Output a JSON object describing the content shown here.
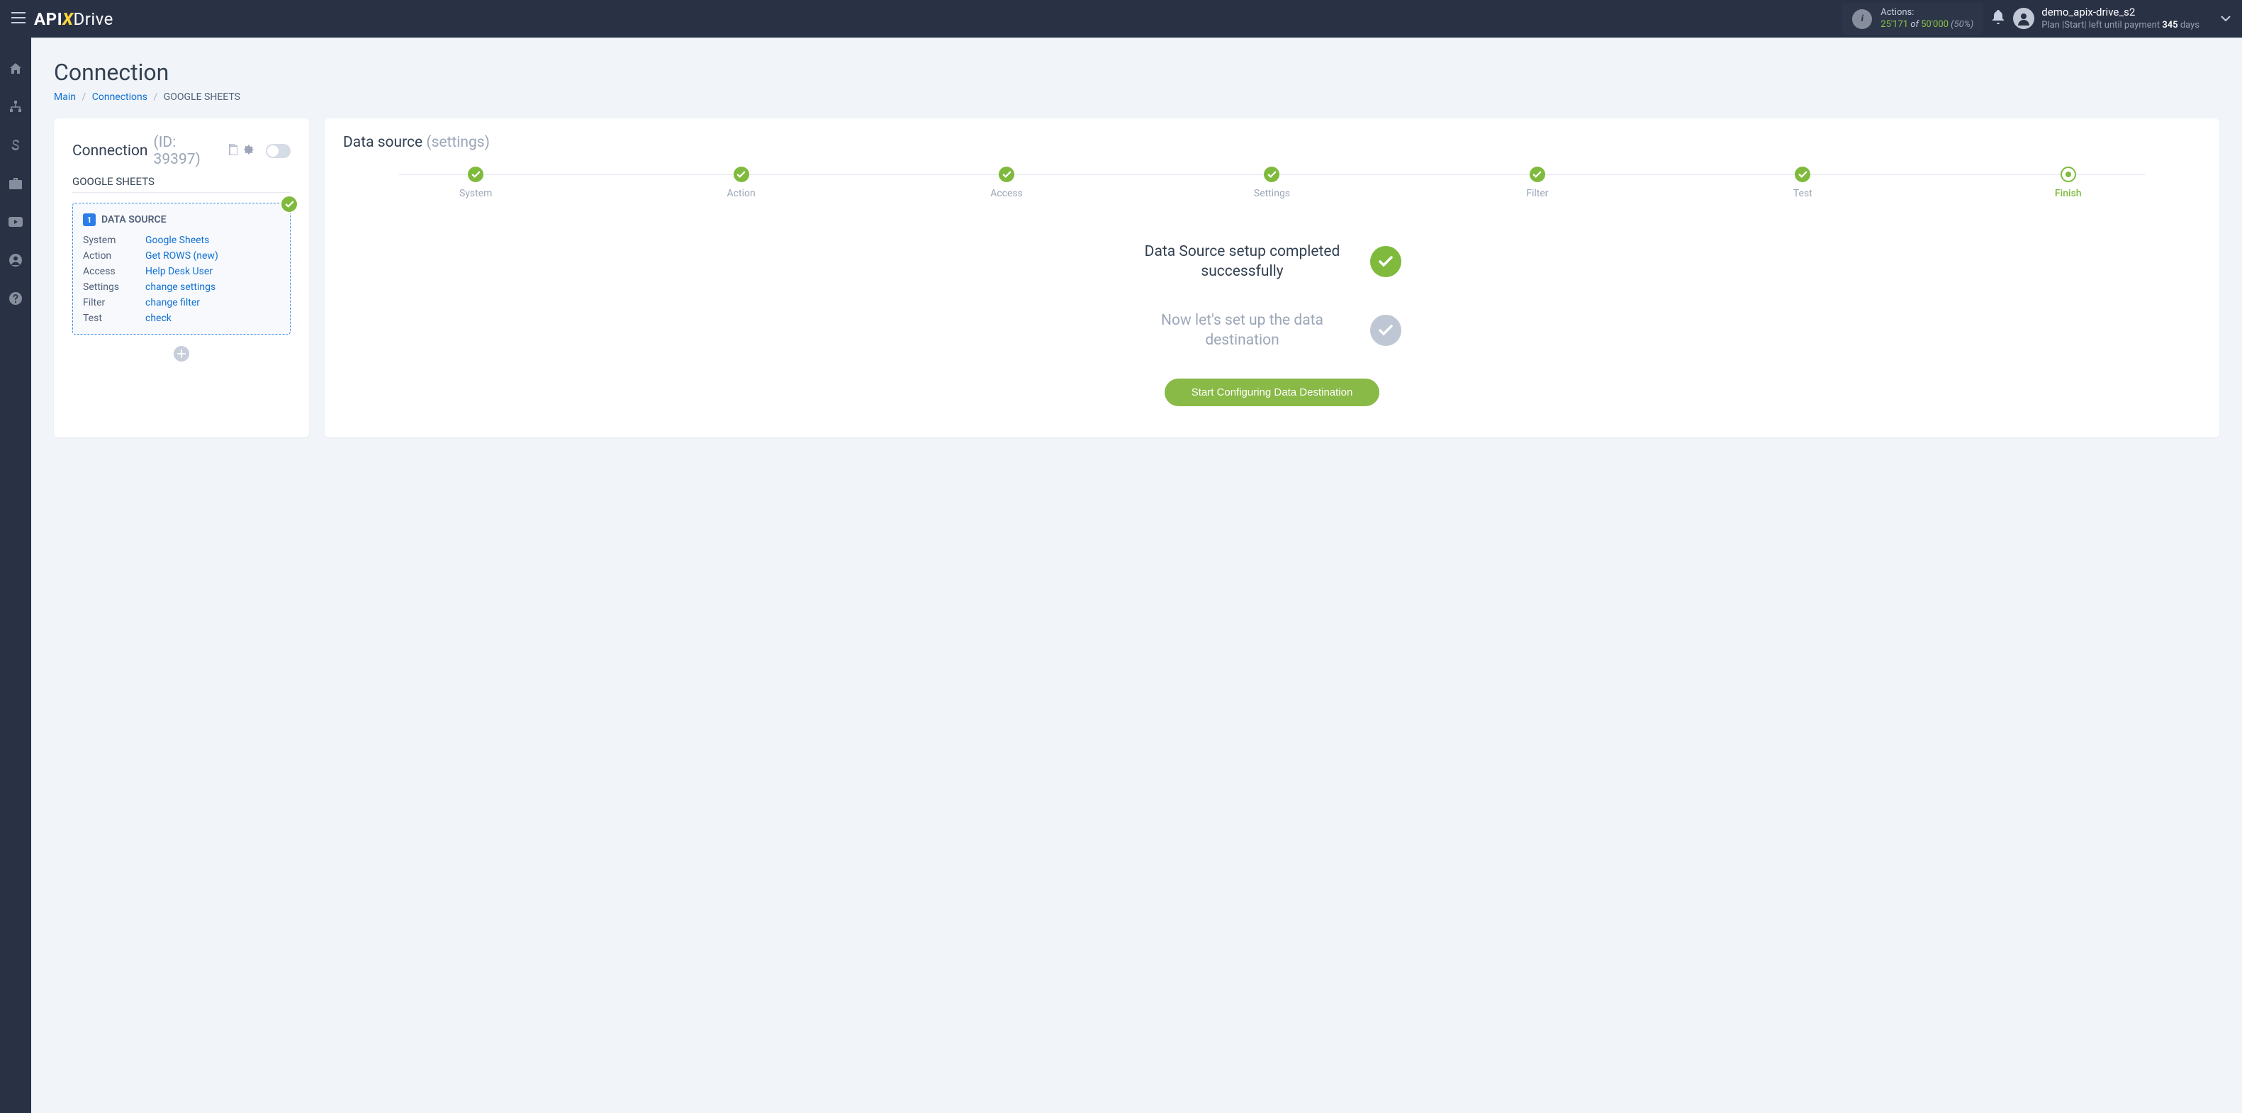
{
  "header": {
    "logo_api": "API",
    "logo_x": "X",
    "logo_drive": "Drive",
    "actions_label": "Actions:",
    "actions_used": "25'171",
    "actions_of": "of",
    "actions_total": "50'000",
    "actions_pct": "(50%)",
    "user_name": "demo_apix-drive_s2",
    "plan_prefix": "Plan |Start| left until payment",
    "plan_days": "345",
    "plan_suffix": "days"
  },
  "page": {
    "title": "Connection"
  },
  "breadcrumb": {
    "main": "Main",
    "connections": "Connections",
    "current": "GOOGLE SHEETS"
  },
  "conn": {
    "title": "Connection",
    "id": "(ID: 39397)",
    "subtitle": "GOOGLE SHEETS"
  },
  "ds_box": {
    "badge": "1",
    "title": "DATA SOURCE",
    "rows": {
      "system_k": "System",
      "system_v": "Google Sheets",
      "action_k": "Action",
      "action_v": "Get ROWS (new)",
      "access_k": "Access",
      "access_v": "Help Desk User",
      "settings_k": "Settings",
      "settings_v": "change settings",
      "filter_k": "Filter",
      "filter_v": "change filter",
      "test_k": "Test",
      "test_v": "check"
    }
  },
  "right": {
    "title": "Data source",
    "subtitle": "(settings)"
  },
  "steps": {
    "system": "System",
    "action": "Action",
    "access": "Access",
    "settings": "Settings",
    "filter": "Filter",
    "test": "Test",
    "finish": "Finish"
  },
  "finish": {
    "row1": "Data Source setup completed successfully",
    "row2": "Now let's set up the data destination",
    "button": "Start Configuring Data Destination"
  }
}
